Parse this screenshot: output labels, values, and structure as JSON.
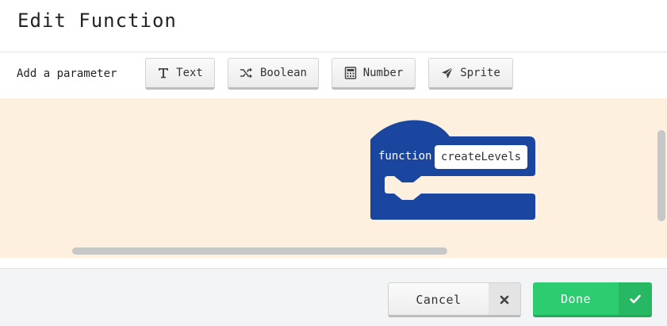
{
  "dialog": {
    "title": "Edit Function"
  },
  "parameters": {
    "label": "Add a parameter",
    "buttons": [
      {
        "label": "Text",
        "icon": "text-icon"
      },
      {
        "label": "Boolean",
        "icon": "shuffle-icon"
      },
      {
        "label": "Number",
        "icon": "calculator-icon"
      },
      {
        "label": "Sprite",
        "icon": "paper-plane-icon"
      }
    ]
  },
  "workspace": {
    "block": {
      "keyword": "function",
      "name": "createLevels",
      "color": "#1a46a0"
    },
    "background": "#fdf0df"
  },
  "footer": {
    "cancel_label": "Cancel",
    "cancel_icon": "close-icon",
    "done_label": "Done",
    "done_icon": "check-icon",
    "done_color": "#2ecc71"
  }
}
